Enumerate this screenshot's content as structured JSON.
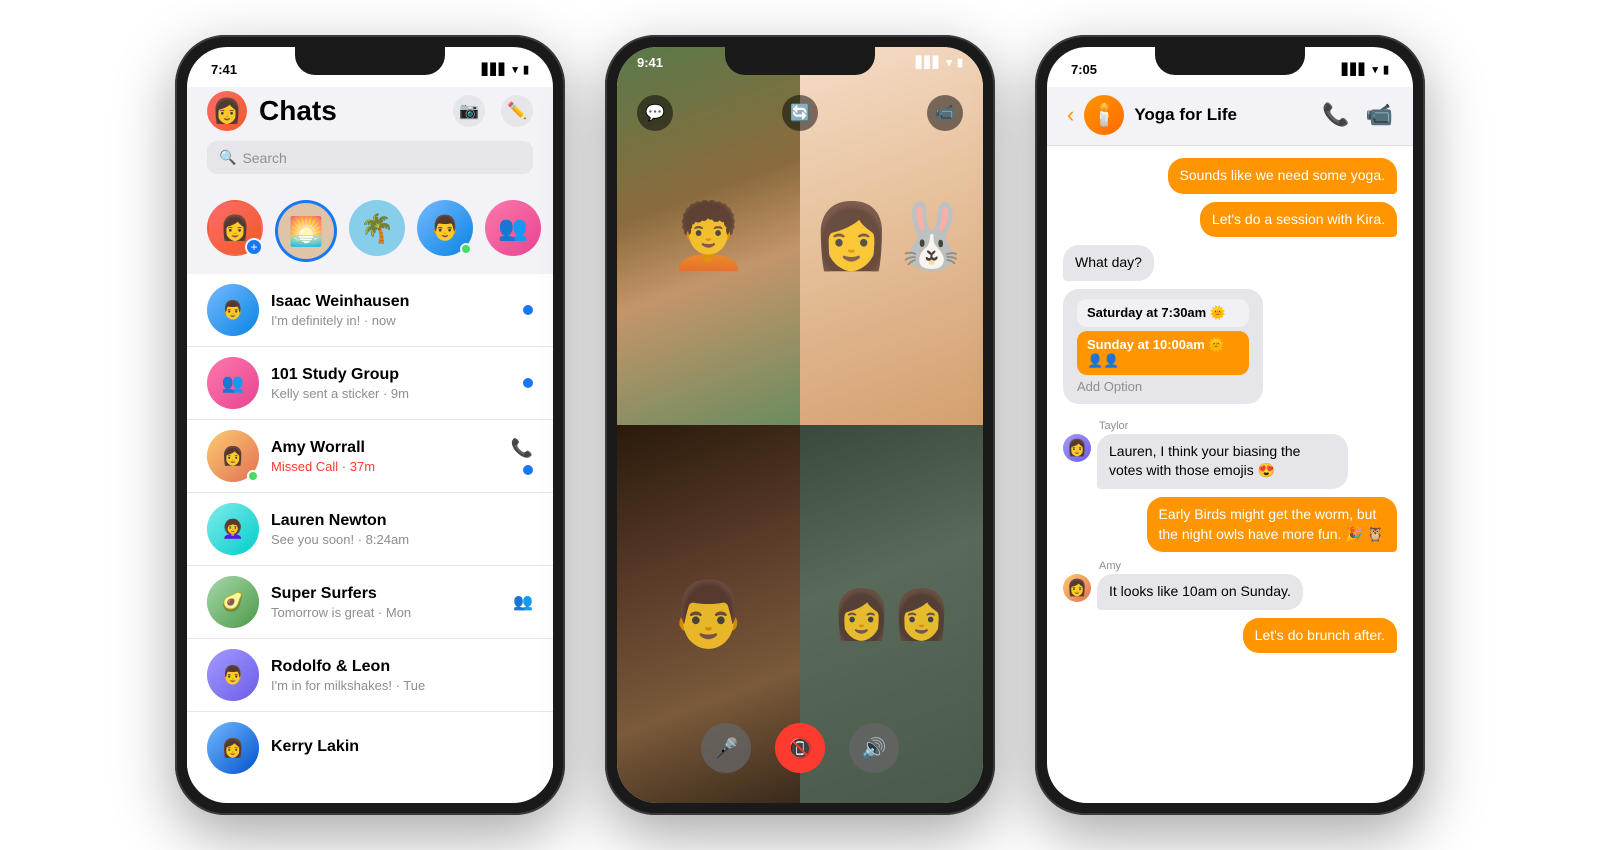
{
  "phone1": {
    "statusBar": {
      "time": "7:41",
      "signal": "▋▋▋",
      "wifi": "WiFi",
      "battery": "🔋"
    },
    "title": "Chats",
    "searchPlaceholder": "Search",
    "stories": [
      {
        "id": "add",
        "hasAdd": true
      },
      {
        "id": "s1",
        "active": true
      },
      {
        "id": "s2"
      },
      {
        "id": "s3",
        "online": true
      },
      {
        "id": "s4"
      },
      {
        "id": "s5"
      }
    ],
    "chats": [
      {
        "name": "Isaac Weinhausen",
        "preview": "I'm definitely in! · now",
        "unread": true,
        "hasCall": false,
        "missedCall": false
      },
      {
        "name": "101 Study Group",
        "preview": "Kelly sent a sticker · 9m",
        "unread": true,
        "hasCall": false,
        "missedCall": false
      },
      {
        "name": "Amy Worrall",
        "preview": "Missed Call · 37m",
        "unread": true,
        "hasCall": true,
        "missedCall": true
      },
      {
        "name": "Lauren Newton",
        "preview": "See you soon! · 8:24am",
        "unread": false,
        "hasCall": false,
        "missedCall": false
      },
      {
        "name": "Super Surfers",
        "preview": "Tomorrow is great · Mon",
        "unread": false,
        "hasCall": false,
        "missedCall": false
      },
      {
        "name": "Rodolfo & Leon",
        "preview": "I'm in for milkshakes! · Tue",
        "unread": false,
        "hasCall": false,
        "missedCall": false
      },
      {
        "name": "Kerry Lakin",
        "preview": "",
        "unread": false,
        "hasCall": false,
        "missedCall": false
      }
    ]
  },
  "phone2": {
    "statusBar": {
      "time": "9:41"
    }
  },
  "phone3": {
    "statusBar": {
      "time": "7:05"
    },
    "groupName": "Yoga for Life",
    "messages": [
      {
        "type": "out",
        "text": "Sounds like we need some yoga."
      },
      {
        "type": "out",
        "text": "Let's do a session with Kira."
      },
      {
        "type": "in-plain",
        "text": "What day?"
      },
      {
        "type": "poll-sat",
        "text": "Saturday at 7:30am 🌞"
      },
      {
        "type": "poll-sun",
        "text": "Sunday at 10:00am 🌞 👤👤"
      },
      {
        "type": "poll-add",
        "text": "Add Option"
      },
      {
        "type": "sender-taylor"
      },
      {
        "type": "in-row",
        "sender": "Taylor",
        "text": "Lauren, I think your biasing the votes with those emojis 😍"
      },
      {
        "type": "out-orange",
        "text": "Early Birds might get the worm, but the night owls have more fun. 🎉 🦉"
      },
      {
        "type": "sender-amy"
      },
      {
        "type": "in-row",
        "sender": "Amy",
        "text": "It looks like 10am on Sunday."
      },
      {
        "type": "out-orange",
        "text": "Let's do brunch after."
      }
    ]
  }
}
